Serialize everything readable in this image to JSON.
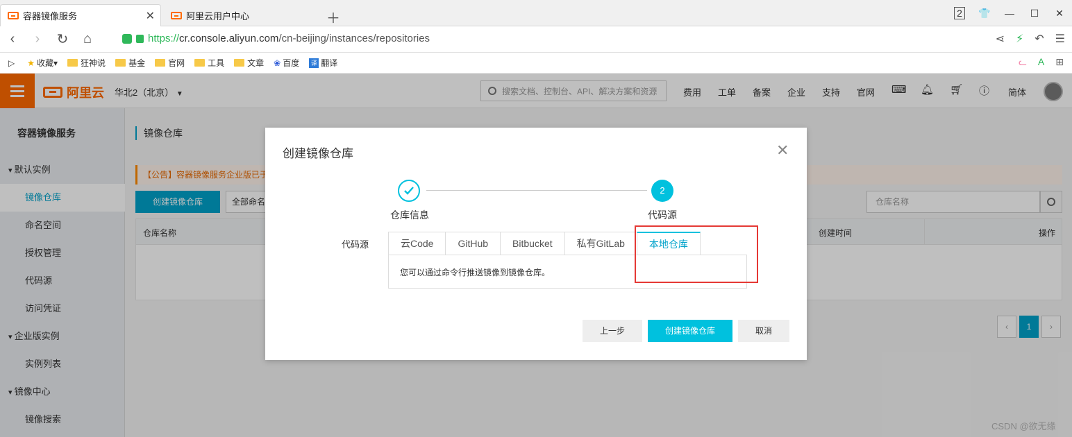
{
  "browser": {
    "tabs": [
      {
        "label": "容器镜像服务",
        "active": true
      },
      {
        "label": "阿里云用户中心",
        "active": false
      }
    ],
    "tab_count": "2",
    "url": {
      "scheme": "https://",
      "host": "cr.console.aliyun.com",
      "path": "/cn-beijing/instances/repositories"
    },
    "bookmarks": [
      "收藏",
      "狂神说",
      "基金",
      "官网",
      "工具",
      "文章",
      "百度",
      "翻译"
    ]
  },
  "console": {
    "brand": "阿里云",
    "region": "华北2（北京）",
    "search_placeholder": "搜索文档、控制台、API、解决方案和资源",
    "nav_links": [
      "费用",
      "工单",
      "备案",
      "企业",
      "支持",
      "官网"
    ],
    "lang": "简体",
    "accent": "#ff6a00",
    "primary": "#00c1de"
  },
  "sidebar": {
    "title": "容器镜像服务",
    "items": [
      {
        "label": "默认实例",
        "group": true
      },
      {
        "label": "镜像仓库",
        "active": true
      },
      {
        "label": "命名空间"
      },
      {
        "label": "授权管理"
      },
      {
        "label": "代码源"
      },
      {
        "label": "访问凭证"
      },
      {
        "label": "企业版实例",
        "group": true
      },
      {
        "label": "实例列表"
      },
      {
        "label": "镜像中心",
        "group": true
      },
      {
        "label": "镜像搜索"
      }
    ]
  },
  "content": {
    "page_title": "镜像仓库",
    "notice": "【公告】容器镜像服务企业版已于",
    "create_button": "创建镜像仓库",
    "namespace_select": "全部命名",
    "repo_search_placeholder": "仓库名称",
    "columns": {
      "name": "仓库名称",
      "created": "创建时间",
      "actions": "操作"
    },
    "page_current": "1"
  },
  "dialog": {
    "title": "创建镜像仓库",
    "steps": [
      {
        "label": "仓库信息",
        "done": true
      },
      {
        "label": "代码源",
        "number": "2"
      }
    ],
    "field_label": "代码源",
    "tabs": [
      "云Code",
      "GitHub",
      "Bitbucket",
      "私有GitLab",
      "本地仓库"
    ],
    "selected_tab": "本地仓库",
    "panel_text": "您可以通过命令行推送镜像到镜像仓库。",
    "buttons": {
      "prev": "上一步",
      "create": "创建镜像仓库",
      "cancel": "取消"
    }
  },
  "watermark": "CSDN @欲无缘"
}
